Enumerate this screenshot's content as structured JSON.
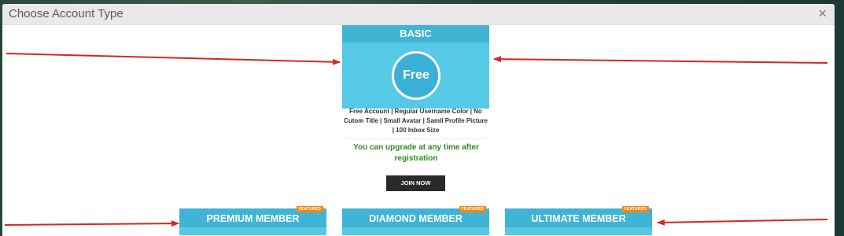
{
  "modal": {
    "title": "Choose Account Type",
    "close_glyph": "×"
  },
  "basic": {
    "name": "BASIC",
    "price": "Free",
    "description": "Free Account | Regular Username Color | No Cutom Title | Small Avatar | Samll Profile Picture | 100 Inbox Size",
    "upgrade_note": "You can upgrade at any time after registration",
    "join_label": "JOIN NOW"
  },
  "plans": [
    {
      "name": "PREMIUM MEMBER",
      "badge": "FEATURED"
    },
    {
      "name": "DIAMOND MEMBER",
      "badge": "FEATURED"
    },
    {
      "name": "ULTIMATE MEMBER",
      "badge": "FEATURED"
    }
  ],
  "colors": {
    "header_blue": "#3fb4d4",
    "body_blue": "#56c9e6",
    "badge_orange": "#f08a16",
    "note_green": "#2e8b1f",
    "annotation_red": "#d9261c"
  }
}
